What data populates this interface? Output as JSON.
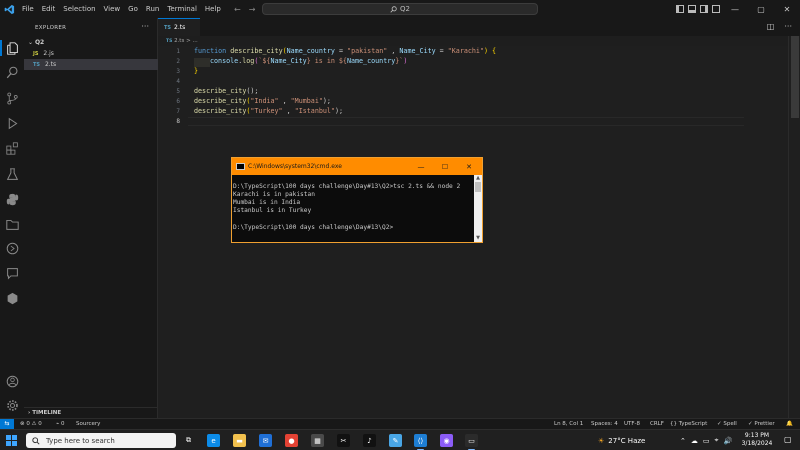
{
  "menu": {
    "items": [
      "File",
      "Edit",
      "Selection",
      "View",
      "Go",
      "Run",
      "Terminal",
      "Help"
    ]
  },
  "titlebar": {
    "search_text": "Q2",
    "back_arrow": "←",
    "forward_arrow": "→",
    "minimize": "—",
    "maximize": "▢",
    "close": "✕"
  },
  "activitybar": {
    "icons": [
      "explorer-icon",
      "search-icon",
      "source-control-icon",
      "run-debug-icon",
      "extensions-icon",
      "testing-icon",
      "python-icon",
      "folder-icon",
      "timeline-icon",
      "chat-icon",
      "hexagon-icon",
      "account-icon",
      "settings-gear-icon"
    ]
  },
  "sidebar": {
    "title": "EXPLORER",
    "more": "···",
    "folder": "Q2",
    "folder_chevron": "⌄",
    "files": [
      {
        "type": "JS",
        "name": "2.js",
        "type_color": "#cbcb41"
      },
      {
        "type": "TS",
        "name": "2.ts",
        "type_color": "#519aba"
      }
    ],
    "timeline": "TIMELINE",
    "timeline_chevron": "›"
  },
  "editor": {
    "tab": {
      "type": "TS",
      "name": "2.ts",
      "close": "✕"
    },
    "tab_actions": [
      "◫",
      "···"
    ],
    "breadcrumb": {
      "type": "TS",
      "file": "2.ts",
      "sep": ">",
      "rest": "..."
    },
    "line_numbers": [
      "1",
      "2",
      "3",
      "4",
      "5",
      "6",
      "7",
      "8"
    ],
    "current_line": 8
  },
  "code": {
    "l1": {
      "kw": "function",
      "fn": "describe_city",
      "p1": "(",
      "param1": "Name_country",
      "eq1": " = ",
      "val1": "\"pakistan\"",
      "sep": " , ",
      "param2": "Name_City",
      "eq2": " = ",
      "val2": "\"Karachi\"",
      "p2": ")",
      "brace": " {"
    },
    "l2": {
      "obj": "console",
      "dot": ".",
      "method": "log",
      "open": "(",
      "tpl_open": "`${",
      "v1": "Name_City",
      "tpl_mid": "} is in ${",
      "v2": "Name_country",
      "tpl_close": "}`",
      "close": ")"
    },
    "l3": "}",
    "l5": {
      "fn": "describe_city",
      "args": "();"
    },
    "l6": {
      "fn": "describe_city",
      "open": "(",
      "a1": "\"India\"",
      "sep": " , ",
      "a2": "\"Mumbai\"",
      "close": ");"
    },
    "l7": {
      "fn": "describe_city",
      "open": "(",
      "a1": "\"Turkey\"",
      "sep": " , ",
      "a2": "\"Istanbul\"",
      "close": ");"
    }
  },
  "cmd": {
    "title": "C:\\Windows\\system32\\cmd.exe",
    "minimize": "—",
    "maximize": "☐",
    "close": "✕",
    "lines": [
      "",
      "D:\\TypeScript\\100 days challenge\\Day#13\\Q2>tsc 2.ts && node 2",
      "Karachi is in pakistan",
      "Mumbai is in India",
      "Istanbul is in Turkey",
      "",
      "D:\\TypeScript\\100 days challenge\\Day#13\\Q2>"
    ],
    "scroll_up": "▲",
    "scroll_down": "▼"
  },
  "statusbar": {
    "remote": "⇆",
    "problems": "⊗ 0 ⚠ 0",
    "ports": "⌁ 0",
    "sourcery": "Sourcery",
    "position": "Ln 8, Col 1",
    "spaces": "Spaces: 4",
    "encoding": "UTF-8",
    "eol": "CRLF",
    "language": "{} TypeScript",
    "spell": "✓ Spell",
    "prettier": "✓ Prettier",
    "bell": "🔔"
  },
  "taskbar": {
    "search_placeholder": "Type here to search",
    "weather": "27°C  Haze",
    "time": "9:13 PM",
    "date": "3/18/2024",
    "apps": [
      {
        "name": "task-view",
        "glyph": "⧉",
        "color": "transparent"
      },
      {
        "name": "edge",
        "glyph": "e",
        "color": "#0c8ce9"
      },
      {
        "name": "file-explorer",
        "glyph": "▬",
        "color": "#f2c14e"
      },
      {
        "name": "mail",
        "glyph": "✉",
        "color": "#1f6fd6"
      },
      {
        "name": "chrome",
        "glyph": "●",
        "color": "#e34234"
      },
      {
        "name": "store",
        "glyph": "▦",
        "color": "#4a4a4a"
      },
      {
        "name": "capcut",
        "glyph": "✂",
        "color": "#111111"
      },
      {
        "name": "tiktok",
        "glyph": "♪",
        "color": "#111111"
      },
      {
        "name": "notepad",
        "glyph": "✎",
        "color": "#49a6e6"
      },
      {
        "name": "vscode",
        "glyph": "⟨⟩",
        "color": "#1e7ed4"
      },
      {
        "name": "messenger",
        "glyph": "◉",
        "color": "#8b5cf6"
      },
      {
        "name": "cmd",
        "glyph": "▭",
        "color": "#2b2b2b"
      }
    ],
    "tray": [
      "⌃",
      "☁",
      "▭",
      "⌖",
      "🔊"
    ],
    "notification": "▢"
  }
}
